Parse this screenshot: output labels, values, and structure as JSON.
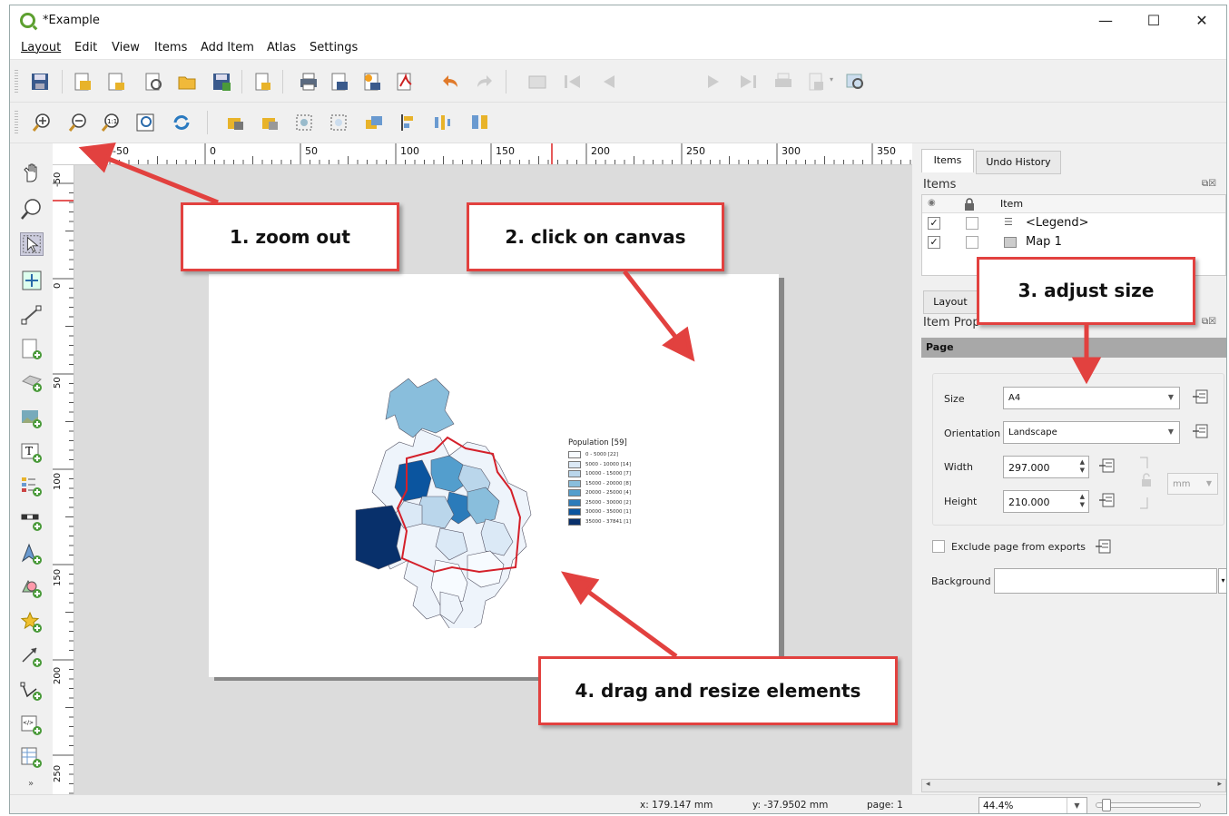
{
  "window": {
    "title": "*Example",
    "minimize": "—",
    "maximize": "☐",
    "close": "✕"
  },
  "menu": [
    "Layout",
    "Edit",
    "View",
    "Items",
    "Add Item",
    "Atlas",
    "Settings"
  ],
  "toolbar": {
    "page_number": "1"
  },
  "ruler": {
    "h_labels": [
      "-50",
      "0",
      "50",
      "100",
      "150",
      "200",
      "250",
      "300",
      "350"
    ],
    "v_labels": [
      "-50",
      "0",
      "50",
      "100",
      "150",
      "200",
      "250"
    ]
  },
  "canvas": {
    "legend": {
      "title": "Population [59]",
      "entries": [
        {
          "label": "0 - 5000 [22]",
          "color": "#f7fbff"
        },
        {
          "label": "5000 - 10000 [14]",
          "color": "#dbe9f6"
        },
        {
          "label": "10000 - 15000 [7]",
          "color": "#bad6eb"
        },
        {
          "label": "15000 - 20000 [8]",
          "color": "#89bedc"
        },
        {
          "label": "20000 - 25000 [4]",
          "color": "#539ecd"
        },
        {
          "label": "25000 - 30000 [2]",
          "color": "#2b7bba"
        },
        {
          "label": "30000 - 35000 [1]",
          "color": "#0b559f"
        },
        {
          "label": "35000 - 37841 [1]",
          "color": "#08306b"
        }
      ]
    }
  },
  "panel": {
    "tabs": [
      "Items",
      "Undo History"
    ],
    "items_title": "Items",
    "col_item": "Item",
    "items": [
      {
        "name": "<Legend>",
        "visible": "✓"
      },
      {
        "name": "Map 1",
        "visible": "✓"
      }
    ],
    "lower_tab": "Layout",
    "props_title": "Item Prop",
    "page_header": "Page",
    "size_label": "Size",
    "size_value": "A4",
    "orientation_label": "Orientation",
    "orientation_value": "Landscape",
    "width_label": "Width",
    "width_value": "297.000",
    "height_label": "Height",
    "height_value": "210.000",
    "unit_value": "mm",
    "exclude_label": "Exclude page from exports",
    "background_label": "Background"
  },
  "status": {
    "x": "x: 179.147 mm",
    "y": "y: -37.9502 mm",
    "page": "page: 1",
    "zoom": "44.4%"
  },
  "callouts": {
    "c1": "1. zoom out",
    "c2": "2. click on canvas",
    "c3": "3. adjust size",
    "c4": "4. drag and resize elements"
  },
  "colors": {
    "callout_border": "#e2413f",
    "arrow": "#e2413f",
    "qgis_green": "#5da030"
  }
}
